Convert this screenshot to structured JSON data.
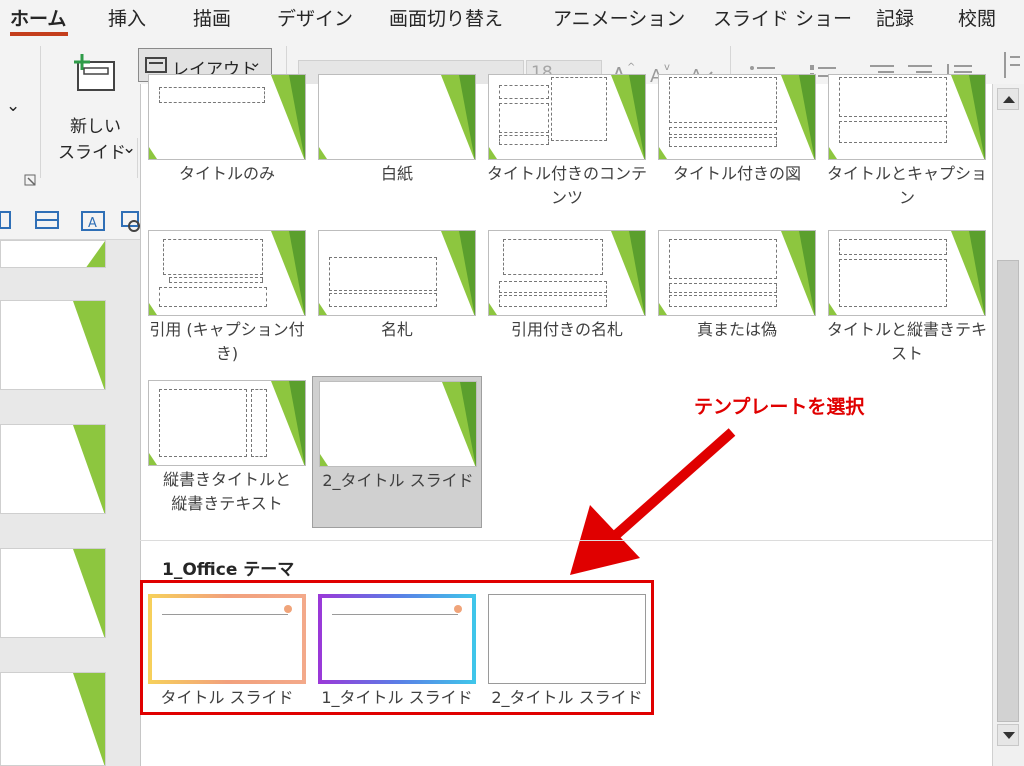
{
  "ribbon_tabs": [
    "ホーム",
    "挿入",
    "描画",
    "デザイン",
    "画面切り替え",
    "アニメーション",
    "スライド ショー",
    "記録",
    "校閲"
  ],
  "ribbon": {
    "new_slide_line1": "新しい",
    "new_slide_line2": "スライド",
    "layout_label": "レイアウト",
    "font_size": "18",
    "dropdown_arrow": "⌄"
  },
  "layouts": [
    {
      "label": "タイトルのみ"
    },
    {
      "label": "白紙"
    },
    {
      "label": "タイトル付きのコンテンツ"
    },
    {
      "label": "タイトル付きの図"
    },
    {
      "label": "タイトルとキャプション"
    },
    {
      "label": "引用 (キャプション付き)"
    },
    {
      "label": "名札"
    },
    {
      "label": "引用付きの名札"
    },
    {
      "label": "真または偽"
    },
    {
      "label": "タイトルと縦書きテキスト"
    },
    {
      "label": "縦書きタイトルと縦書きテキスト"
    },
    {
      "label": "2_タイトル スライド"
    }
  ],
  "section": {
    "title": "1_Office テーマ",
    "templates": [
      {
        "label": "タイトル スライド"
      },
      {
        "label": "1_タイトル スライド"
      },
      {
        "label": "2_タイトル スライド"
      }
    ]
  },
  "annotation": "テンプレートを選択",
  "colors": {
    "accent_tab": "#c43e1c",
    "annotation_red": "#e00000",
    "slide_green": "#8dc63f"
  }
}
